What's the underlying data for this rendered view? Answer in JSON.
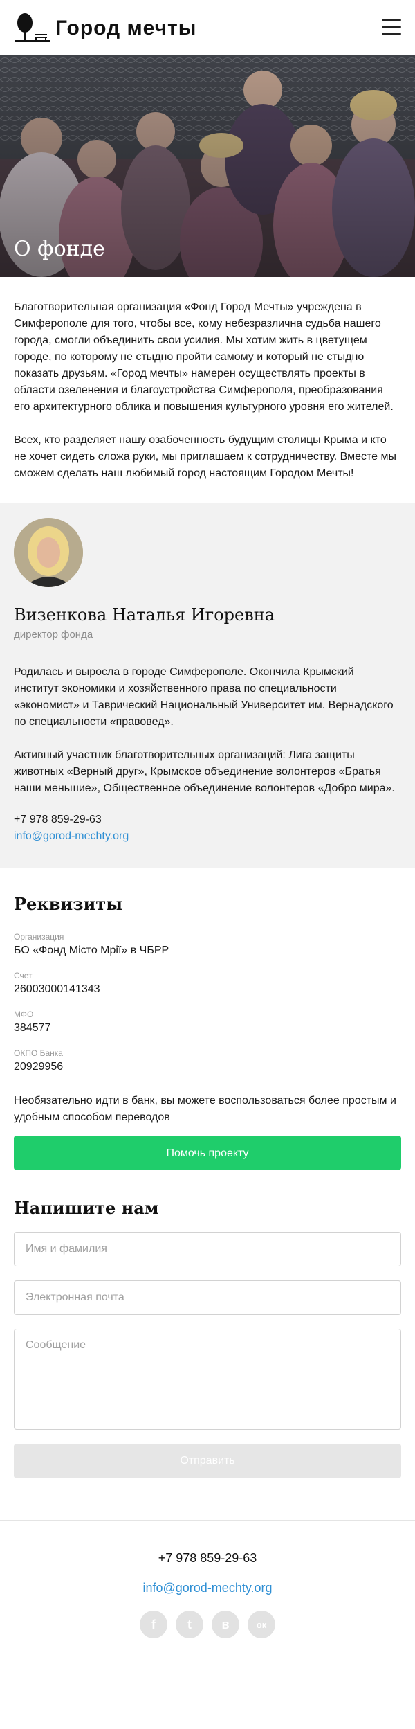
{
  "header": {
    "logo_text": "Город мечты",
    "menu_icon": "hamburger-menu-icon"
  },
  "hero": {
    "title": "О фонде"
  },
  "about": {
    "paragraphs": [
      "Благотворительная организация «Фонд Город Мечты» учреждена в Симферополе для того, чтобы все, кому небезразлична судьба нашего города, смогли объединить свои усилия. Мы хотим жить в цветущем городе, по которому не стыдно пройти самому и который не стыдно показать друзьям. «Город мечты» намерен осуществлять проекты в области озеленения и благоустройства Симферополя, преобразования его архитектурного облика и повышения культурного уровня его жителей.",
      "Всех, кто разделяет нашу озабоченность будущим столицы Крыма и кто не хочет сидеть сложа руки, мы приглашаем к сотрудничеству. Вместе мы сможем сделать наш любимый город настоящим Городом Мечты!"
    ]
  },
  "person": {
    "name": "Визенкова Наталья Игоревна",
    "role": "директор фонда",
    "bio": [
      "Родилась и выросла в городе Симферополе. Окончила Крымский институт экономики и хозяйственного права по специальности «экономист» и Таврический Национальный Университет им. Вернадского по специальности «правовед».",
      "Активный участник благотворительных организаций: Лига защиты животных «Верный друг», Крымское объединение волонтеров «Братья наши меньшие», Общественное объединение волонтеров «Добро мира»."
    ],
    "phone": "+7 978 859-29-63",
    "email": "info@gorod-mechty.org"
  },
  "requisites": {
    "title": "Реквизиты",
    "items": [
      {
        "label": "Организация",
        "value": "БО «Фонд Місто Мрії» в ЧБРР"
      },
      {
        "label": "Счет",
        "value": "26003000141343"
      },
      {
        "label": "МФО",
        "value": "384577"
      },
      {
        "label": "ОКПО Банка",
        "value": "20929956"
      }
    ],
    "note": "Необязательно идти в банк, вы можете воспользоваться более простым и удобным способом переводов",
    "help_button": "Помочь проекту"
  },
  "contact": {
    "title": "Напишите нам",
    "name_placeholder": "Имя и фамилия",
    "email_placeholder": "Электронная почта",
    "message_placeholder": "Сообщение",
    "submit_label": "Отправить"
  },
  "footer": {
    "phone": "+7 978 859-29-63",
    "email": "info@gorod-mechty.org",
    "socials": [
      {
        "icon": "facebook-icon",
        "glyph": "f"
      },
      {
        "icon": "twitter-icon",
        "glyph": "t"
      },
      {
        "icon": "vk-icon",
        "glyph": "в"
      },
      {
        "icon": "odnoklassniki-icon",
        "glyph": "ок"
      }
    ]
  },
  "colors": {
    "accent_green": "#1fcd6b",
    "link_blue": "#2f8fd4",
    "panel_gray": "#f2f2f2",
    "disabled_gray": "#e6e6e6"
  }
}
